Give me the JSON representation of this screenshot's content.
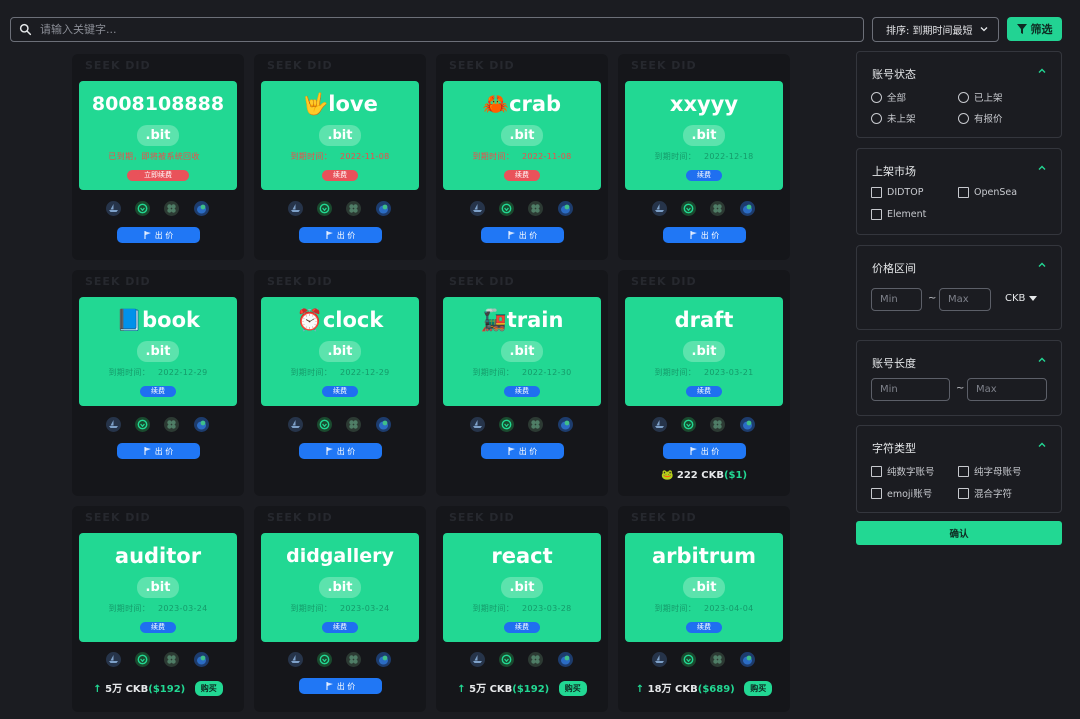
{
  "search": {
    "placeholder": "请输入关键字..."
  },
  "sort": {
    "label": "排序: 到期时间最短"
  },
  "filter_button": {
    "label": "筛选"
  },
  "watermark": "SEEK DID",
  "offer_label": "出 价",
  "buy_label": "购买",
  "cards": [
    {
      "name": "8008108888",
      "suffix": ".bit",
      "expiry_label": "已到期，即将被系统回收",
      "expiry_date": "",
      "renew_label": "立即续费",
      "expired": true
    },
    {
      "name": "🤟love",
      "suffix": ".bit",
      "expiry_label": "到期时间：",
      "expiry_date": "2022-11-08",
      "renew_label": "续费",
      "expired": true
    },
    {
      "name": "🦀crab",
      "suffix": ".bit",
      "expiry_label": "到期时间：",
      "expiry_date": "2022-11-08",
      "renew_label": "续费",
      "expired": true
    },
    {
      "name": "xxyyy",
      "suffix": ".bit",
      "expiry_label": "到期时间：",
      "expiry_date": "2022-12-18",
      "renew_label": "续费",
      "expired": false
    },
    {
      "name": "📘book",
      "suffix": ".bit",
      "expiry_label": "到期时间：",
      "expiry_date": "2022-12-29",
      "renew_label": "续费",
      "expired": false
    },
    {
      "name": "⏰clock",
      "suffix": ".bit",
      "expiry_label": "到期时间：",
      "expiry_date": "2022-12-29",
      "renew_label": "续费",
      "expired": false
    },
    {
      "name": "🚂train",
      "suffix": ".bit",
      "expiry_label": "到期时间：",
      "expiry_date": "2022-12-30",
      "renew_label": "续费",
      "expired": false
    },
    {
      "name": "draft",
      "suffix": ".bit",
      "expiry_label": "到期时间：",
      "expiry_date": "2023-03-21",
      "renew_label": "续费",
      "expired": false,
      "price": "222 CKB",
      "usd": "($1)"
    },
    {
      "name": "auditor",
      "suffix": ".bit",
      "expiry_label": "到期时间：",
      "expiry_date": "2023-03-24",
      "renew_label": "续费",
      "expired": false,
      "price": "5万 CKB",
      "usd": "($192)",
      "buy": true
    },
    {
      "name": "didgallery",
      "suffix": ".bit",
      "expiry_label": "到期时间：",
      "expiry_date": "2023-03-24",
      "renew_label": "续费",
      "expired": false
    },
    {
      "name": "react",
      "suffix": ".bit",
      "expiry_label": "到期时间：",
      "expiry_date": "2023-03-28",
      "renew_label": "续费",
      "expired": false,
      "price": "5万 CKB",
      "usd": "($192)",
      "buy": true
    },
    {
      "name": "arbitrum",
      "suffix": ".bit",
      "expiry_label": "到期时间：",
      "expiry_date": "2023-04-04",
      "renew_label": "续费",
      "expired": false,
      "price": "18万 CKB",
      "usd": "($689)",
      "buy": true
    }
  ],
  "sidebar": {
    "status": {
      "title": "账号状态",
      "options": [
        "全部",
        "已上架",
        "未上架",
        "有报价"
      ]
    },
    "market": {
      "title": "上架市场",
      "options": [
        "DIDTOP",
        "OpenSea",
        "Element"
      ]
    },
    "price": {
      "title": "价格区间",
      "min_placeholder": "Min",
      "max_placeholder": "Max",
      "currency": "CKB"
    },
    "length": {
      "title": "账号长度",
      "min_placeholder": "Min",
      "max_placeholder": "Max"
    },
    "chartype": {
      "title": "字符类型",
      "options": [
        "纯数字账号",
        "纯字母账号",
        "emoji账号",
        "混合字符"
      ]
    },
    "confirm_label": "确认"
  },
  "colors": {
    "accent": "#22d893",
    "background": "#1b1c21",
    "card": "#15161a",
    "offer": "#2077f5",
    "expired": "#e9525a"
  }
}
